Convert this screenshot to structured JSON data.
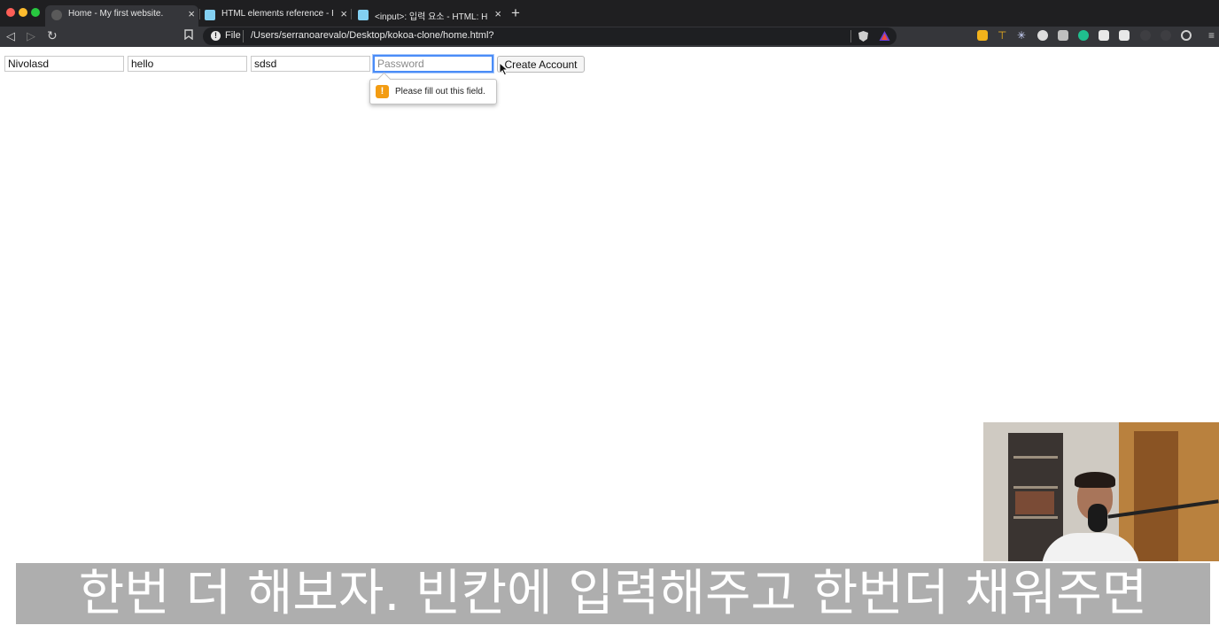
{
  "browser": {
    "tabs": [
      {
        "title": "Home - My first website.",
        "close": "×"
      },
      {
        "title": "HTML elements reference - HTML",
        "close": "×"
      },
      {
        "title": "<input>: 입력 요소 - HTML: Hyper",
        "close": "×"
      }
    ],
    "new_tab": "+",
    "scheme": "File",
    "url": "/Users/serranoarevalo/Desktop/kokoa-clone/home.html?"
  },
  "form": {
    "field1_value": "Nivolasd",
    "field2_value": "hello",
    "field3_value": "sdsd",
    "password_placeholder": "Password",
    "submit_label": "Create Account"
  },
  "validation": {
    "message": "Please fill out this field.",
    "icon": "!"
  },
  "subtitle": "한번 더 해보자. 빈칸에 입력해주고 한번더 채워주면",
  "colors": {
    "focus_ring": "#4a8cf7",
    "warning": "#f39c12",
    "tab_strip": "#1f1f21",
    "toolbar": "#35363a"
  }
}
